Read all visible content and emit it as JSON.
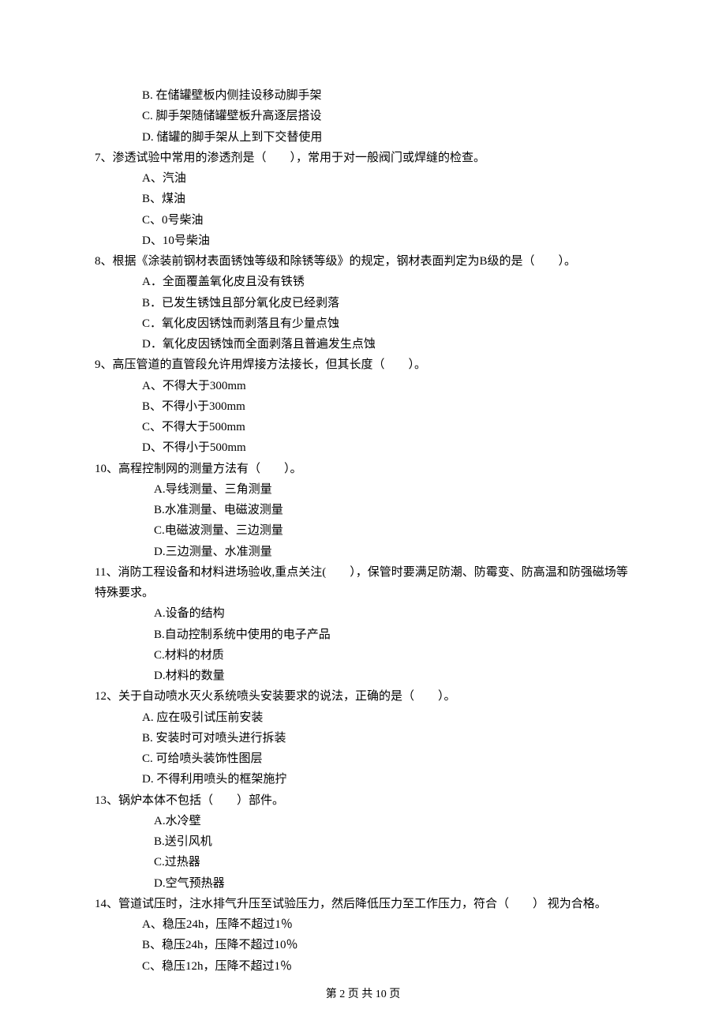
{
  "prelude": [
    "B. 在储罐壁板内侧挂设移动脚手架",
    "C. 脚手架随储罐壁板升高逐层搭设",
    "D. 储罐的脚手架从上到下交替使用"
  ],
  "questions": [
    {
      "stem": "7、渗透试验中常用的渗透剂是（　　），常用于对一般阀门或焊缝的检查。",
      "opts": [
        "A、汽油",
        "B、煤油",
        "C、0号柴油",
        "D、10号柴油"
      ]
    },
    {
      "stem": "8、根据《涂装前钢材表面锈蚀等级和除锈等级》的规定，钢材表面判定为B级的是（　　）。",
      "opts": [
        "A．全面覆盖氧化皮且没有铁锈",
        "B．已发生锈蚀且部分氧化皮已经剥落",
        "C．氧化皮因锈蚀而剥落且有少量点蚀",
        "D．氧化皮因锈蚀而全面剥落且普遍发生点蚀"
      ],
      "optIndent": "indent-opt"
    },
    {
      "stem": "9、高压管道的直管段允许用焊接方法接长，但其长度（　　）。",
      "opts": [
        "A、不得大于300mm",
        "B、不得小于300mm",
        "C、不得大于500mm",
        "D、不得小于500mm"
      ]
    },
    {
      "stem": "10、高程控制网的测量方法有（　　）。",
      "opts": [
        "A.导线测量、三角测量",
        "B.水准测量、电磁波测量",
        "C.电磁波测量、三边测量",
        "D.三边测量、水准测量"
      ],
      "optIndent": "indent-sub"
    },
    {
      "stem": "11、消防工程设备和材料进场验收,重点关注(　　），保管时要满足防潮、防霉变、防高温和防强磁场等特殊要求。",
      "opts": [
        "A.设备的结构",
        "B.自动控制系统中使用的电子产品",
        "C.材料的材质",
        "D.材料的数量"
      ],
      "optIndent": "indent-sub",
      "wrap": true
    },
    {
      "stem": "12、关于自动喷水灭火系统喷头安装要求的说法，正确的是（　　）。",
      "opts": [
        "A. 应在吸引试压前安装",
        "B. 安装时可对喷头进行拆装",
        "C. 可给喷头装饰性图层",
        "D. 不得利用喷头的框架施拧"
      ],
      "optIndent": "indent-opt"
    },
    {
      "stem": "13、锅炉本体不包括（　　）部件。",
      "opts": [
        "A.水冷壁",
        "B.送引风机",
        "C.过热器",
        "D.空气预热器"
      ],
      "optIndent": "indent-sub"
    },
    {
      "stem": "14、管道试压时，注水排气升压至试验压力，然后降低压力至工作压力，符合（　　） 视为合格。",
      "opts": [
        "A、稳压24h，压降不超过1％",
        "B、稳压24h，压降不超过10％",
        "C、稳压12h，压降不超过1％"
      ],
      "wrap": true
    }
  ],
  "footer": {
    "text": "第 2 页 共 10 页"
  }
}
